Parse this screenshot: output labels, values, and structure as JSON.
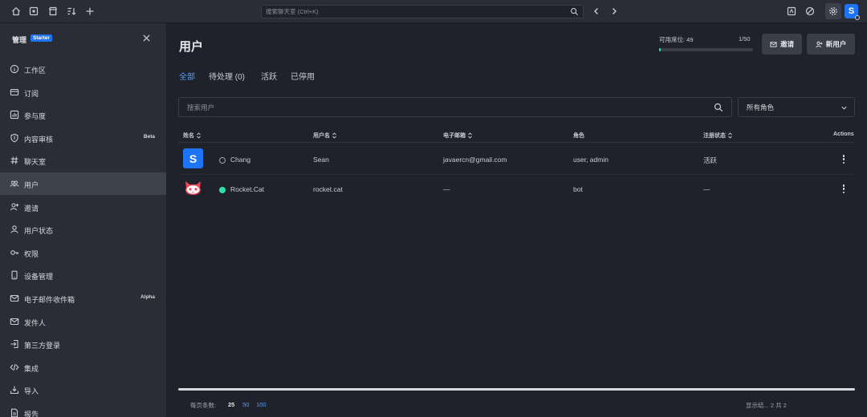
{
  "topbar": {
    "search_placeholder": "搜索聊天室 (Ctrl+K)",
    "avatar_letter": "S"
  },
  "sidebar": {
    "title": "管理",
    "badge": "Starter",
    "items": [
      {
        "label": "工作区",
        "icon": "info-icon"
      },
      {
        "label": "订阅",
        "icon": "card-icon"
      },
      {
        "label": "参与度",
        "icon": "chart-icon"
      },
      {
        "label": "内容审核",
        "icon": "shield-icon",
        "tag": "Beta"
      },
      {
        "label": "聊天室",
        "icon": "hash-icon"
      },
      {
        "label": "用户",
        "icon": "team-icon",
        "active": true
      },
      {
        "label": "邀请",
        "icon": "user-plus-icon"
      },
      {
        "label": "用户状态",
        "icon": "user-icon"
      },
      {
        "label": "权限",
        "icon": "key-icon"
      },
      {
        "label": "设备管理",
        "icon": "mobile-icon"
      },
      {
        "label": "电子邮件收件箱",
        "icon": "mail-icon",
        "tag": "Alpha"
      },
      {
        "label": "发件人",
        "icon": "mail-icon"
      },
      {
        "label": "第三方登录",
        "icon": "login-icon"
      },
      {
        "label": "集成",
        "icon": "code-icon"
      },
      {
        "label": "导入",
        "icon": "import-icon"
      },
      {
        "label": "报告",
        "icon": "file-icon"
      }
    ]
  },
  "main": {
    "title": "用户",
    "seats_label": "可用席位: 49",
    "seats_count": "1/50",
    "seats_fraction": 0.02,
    "invite_button": "邀请",
    "new_user_button": "新用户",
    "tabs": [
      "全部",
      "待处理 (0)",
      "活跃",
      "已停用"
    ],
    "search_placeholder": "搜索用户",
    "roles_select": "所有角色",
    "columns": [
      "姓名",
      "用户名",
      "电子邮箱",
      "角色",
      "注册状态",
      "Actions"
    ],
    "rows": [
      {
        "name": "Chang",
        "username": "Sean",
        "email": "javaercn@gmail.com",
        "roles": "user, admin",
        "status": "活跃",
        "avatar": "S"
      },
      {
        "name": "Rocket.Cat",
        "username": "rocket.cat",
        "email": "—",
        "roles": "bot",
        "status": "—",
        "avatar": ""
      }
    ],
    "pagination": {
      "label": "每页条数:",
      "sizes": [
        "25",
        "50",
        "100"
      ],
      "right_text": "显示结... 2 共 2"
    }
  },
  "colors": {
    "accent": "#1d74f5",
    "link": "#549df9",
    "online": "#2de0a5"
  }
}
